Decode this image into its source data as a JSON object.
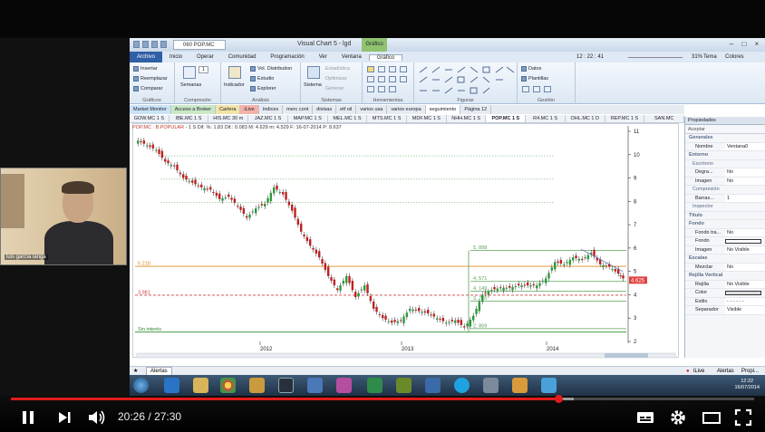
{
  "video": {
    "current_time": "20:26",
    "duration": "27:30",
    "time_sep": "/",
    "progress_fraction": 0.737,
    "buffered_fraction": 0.757
  },
  "window": {
    "file_box": "060 POP.MC",
    "title": "Visual Chart 5 - lgd",
    "context_tab": "Gráfico"
  },
  "menu": {
    "items": [
      "Archivo",
      "Inicio",
      "Operar",
      "Comunidad",
      "Programación",
      "Ver",
      "Ventana",
      "Gráfico"
    ],
    "time": "12 : 22 : 41",
    "zoom": "31%",
    "tema": "Tema",
    "colores": "Colores"
  },
  "ribbon": {
    "graficos": {
      "label": "Gráficos",
      "insertar": "Insertar",
      "reemplazar": "Reemplazar",
      "comparar": "Comparar"
    },
    "compresion": {
      "label": "Compresión",
      "semanas": "Semanas",
      "value": "1"
    },
    "analisis": {
      "label": "Análisis",
      "indicador": "Indicador",
      "vol_dist": "Vol. Distribution",
      "estudio": "Estudio",
      "explorer": "Explorer"
    },
    "sistemas": {
      "label": "Sistemas",
      "sistema": "Sistema",
      "estadistica": "Estadística",
      "optimizar": "Optimizar",
      "generar": "Generar"
    },
    "herramientas": {
      "label": "Herramientas"
    },
    "figuras": {
      "label": "Figuras"
    },
    "gestion": {
      "label": "Gestión",
      "datos": "Datos",
      "plantillas": "Plantillas"
    }
  },
  "tabs_row1": [
    "Market Monitor",
    "Acceso a Broker",
    "Cartera",
    "iLive",
    "índices",
    "merc cont",
    "divisas",
    "etf oil",
    "varios usa",
    "varios europa",
    "seguimiento",
    "Página 12"
  ],
  "tabs_row2": [
    "GOW.MC 1 S",
    "IBE.MC 1 S",
    "HIS.MC 30 m",
    "JAZ.MC 1 S",
    "MAP.MC 1 S",
    "MEL.MC 1 S",
    "MTS.MC 1 S",
    "MDF.MC 1 S",
    "NHH.MC 1 S",
    "POP.MC 1 S",
    "R4.MC 1 S",
    "OHL.MC 1 D",
    "REP.MC 1 S",
    "SAN.MC"
  ],
  "active_tab2": "POP.MC 1 S",
  "chart_header": {
    "ticker": "POP.MC : B.POPULAR",
    "text": "- 1 S  Dif. %: 1.83  Dif.: 0.083  M: 4.629  m: 4.529  F: 16-07-2014  P: 8.637"
  },
  "chart_data": {
    "type": "candlestick",
    "x_ticks": [
      "2012",
      "2013",
      "2014"
    ],
    "y_ticks": [
      "11",
      "10",
      "9",
      "8",
      "7",
      "6",
      "5",
      "4",
      "3",
      "2"
    ],
    "ylim": [
      2,
      11
    ],
    "last_price_label": "4.625",
    "levels": [
      {
        "label": "5.218",
        "value": 5.218
      },
      {
        "label": "3.981",
        "value": 3.981
      },
      {
        "label": "5, 898",
        "value": 5.898
      },
      {
        "label": "4, 571",
        "value": 4.571
      },
      {
        "label": "4, 149",
        "value": 4.149
      },
      {
        "label": "3, 726",
        "value": 3.726
      },
      {
        "label": "2, 869",
        "value": 2.549
      },
      {
        "label": "Sin interés",
        "value": 2.4
      }
    ]
  },
  "properties": {
    "title": "Propiedades",
    "toolbar": "Aceptar",
    "rows": [
      {
        "type": "sec",
        "k": "Generales"
      },
      {
        "type": "row",
        "k": "Nombre",
        "v": "Ventana0"
      },
      {
        "type": "sec",
        "k": "Entorno"
      },
      {
        "type": "sub",
        "k": "Escritorio"
      },
      {
        "type": "row",
        "k": "Degra...",
        "v": "No"
      },
      {
        "type": "row",
        "k": "Imagen",
        "v": "No"
      },
      {
        "type": "sub",
        "k": "Compresión"
      },
      {
        "type": "row",
        "k": "Barras...",
        "v": "1"
      },
      {
        "type": "sub",
        "k": "Inspector"
      },
      {
        "type": "sec",
        "k": "Título"
      },
      {
        "type": "sec",
        "k": "Fondo"
      },
      {
        "type": "row",
        "k": "Fondo tra...",
        "v": "No"
      },
      {
        "type": "row",
        "k": "Fondo",
        "v": ""
      },
      {
        "type": "row",
        "k": "Imagen",
        "v": "No Visible"
      },
      {
        "type": "sec",
        "k": "Escalas"
      },
      {
        "type": "row",
        "k": "Mezclar",
        "v": "No"
      },
      {
        "type": "sec",
        "k": "Rejilla Vertical"
      },
      {
        "type": "row",
        "k": "Rejilla",
        "v": "No Visible"
      },
      {
        "type": "row",
        "k": "Color",
        "v": ""
      },
      {
        "type": "row",
        "k": "Estilo",
        "v": "- - - - - -"
      },
      {
        "type": "row",
        "k": "Separador",
        "v": "Visible"
      }
    ]
  },
  "bottom": {
    "alertas": "Alertas",
    "ilive": "iLive",
    "alertas2": "Alertas",
    "props": "Propi..."
  },
  "taskbar": {
    "time": "12:22",
    "date": "16/07/2014"
  },
  "webcam": {
    "name": "luis garcía langa"
  }
}
